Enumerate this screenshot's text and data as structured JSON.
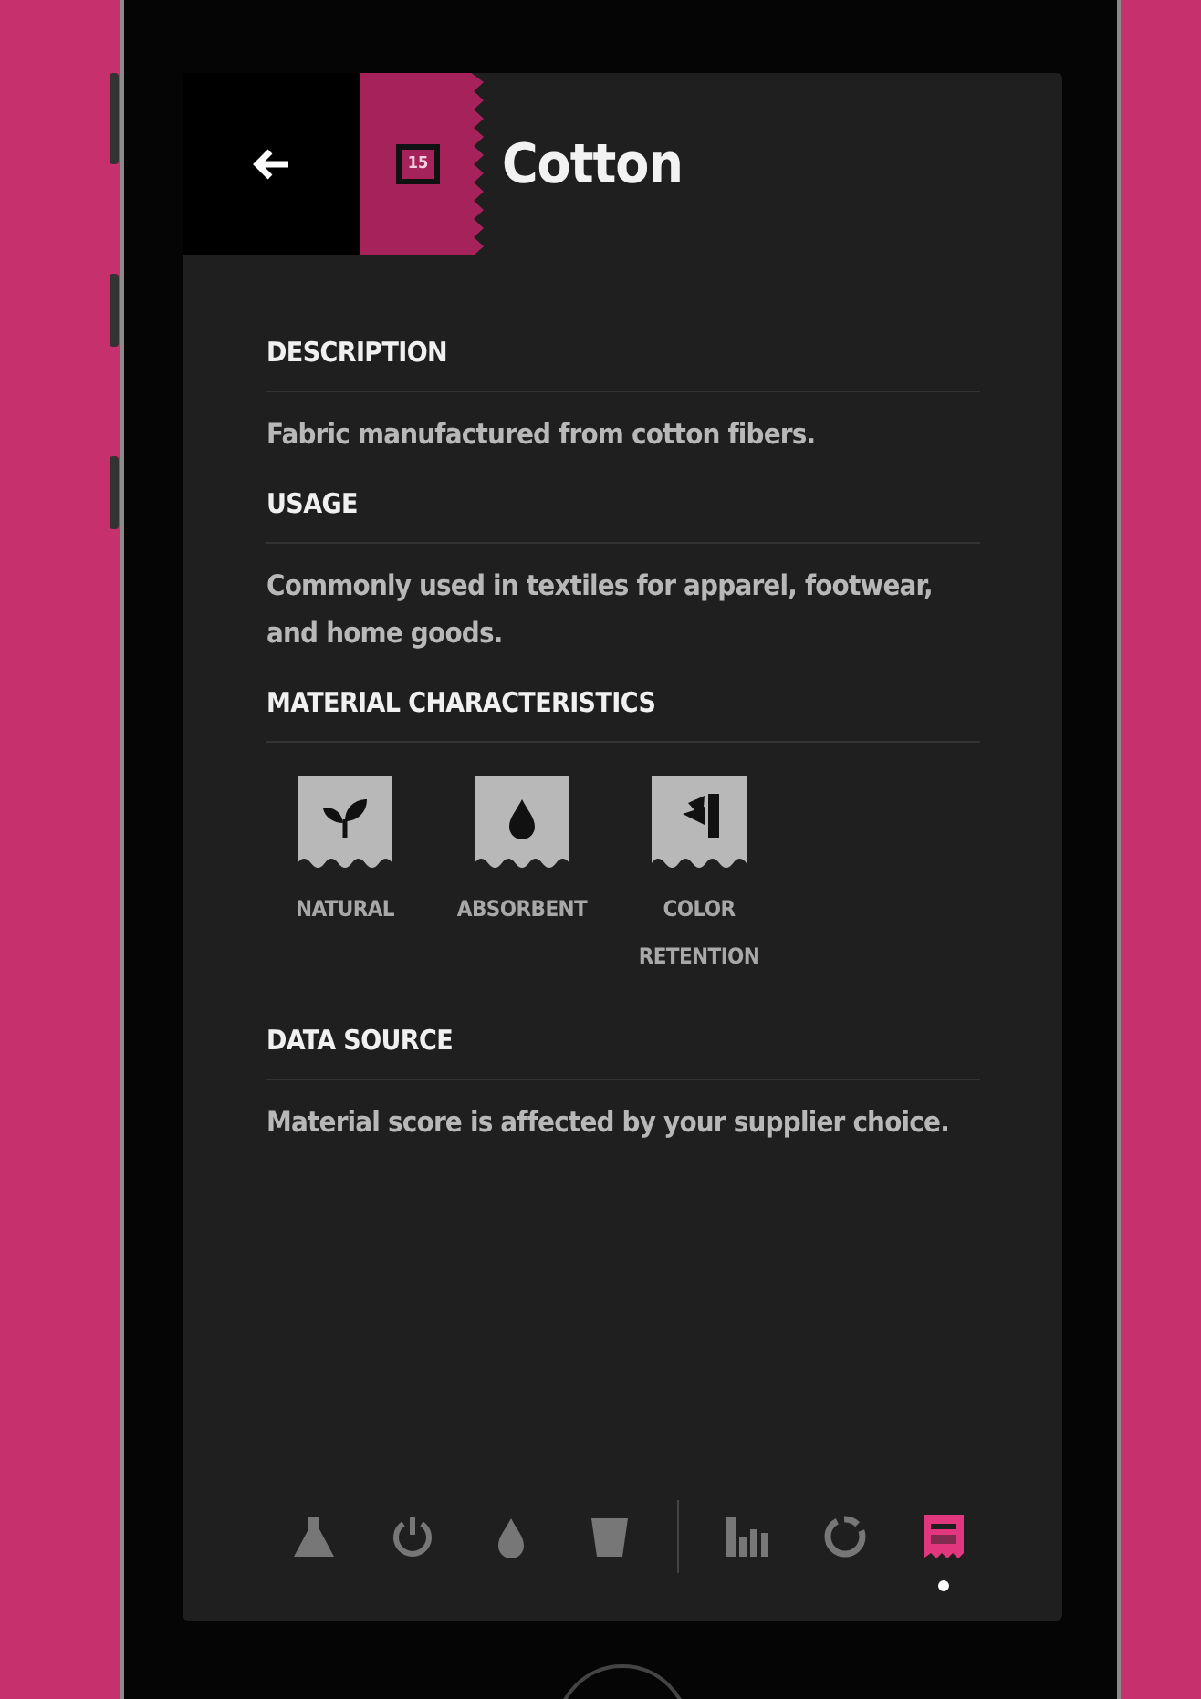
{
  "header": {
    "badge": "15",
    "title": "Cotton"
  },
  "sections": [
    {
      "kind": "text",
      "heading": "DESCRIPTION",
      "text": "Fabric manufactured from cotton fibers."
    },
    {
      "kind": "text",
      "heading": "USAGE",
      "text": "Commonly used in textiles for apparel, footwear, and home goods."
    },
    {
      "kind": "characteristics",
      "heading": "MATERIAL CHARACTERISTICS",
      "items": [
        {
          "kind": "sprout",
          "label": "NATURAL"
        },
        {
          "kind": "drop",
          "label": "ABSORBENT"
        },
        {
          "kind": "swatch",
          "label": "COLOR RETENTION"
        }
      ]
    },
    {
      "kind": "text",
      "heading": "DATA SOURCE",
      "text": "Material score is affected by your supplier choice."
    }
  ],
  "nav": {
    "groups": [
      [
        {
          "kind": "flask",
          "selected": false
        },
        {
          "kind": "power",
          "selected": false
        },
        {
          "kind": "drop",
          "selected": false
        },
        {
          "kind": "cup",
          "selected": false
        }
      ],
      [
        {
          "kind": "bars",
          "selected": false
        },
        {
          "kind": "ring",
          "selected": false
        },
        {
          "kind": "tag",
          "selected": true
        }
      ]
    ]
  }
}
